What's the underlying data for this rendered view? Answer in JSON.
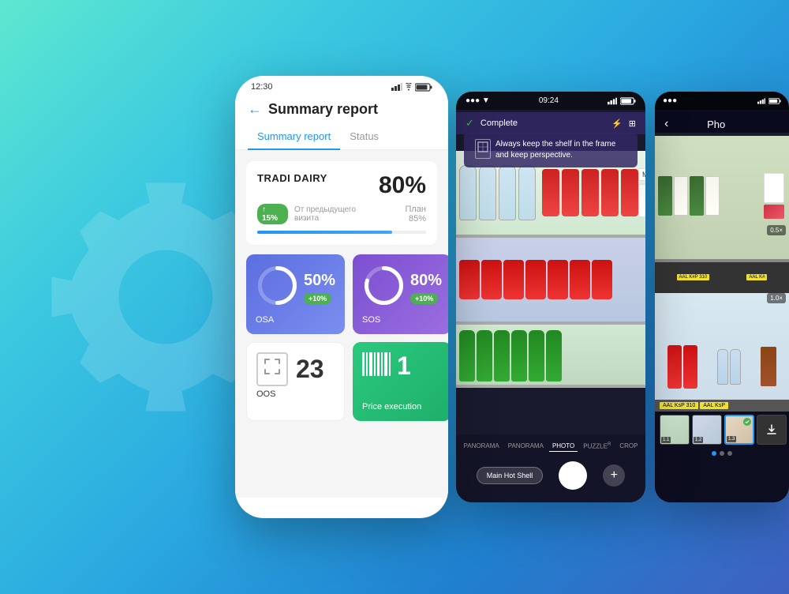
{
  "background": {
    "gradient_start": "#5de8d0",
    "gradient_end": "#4060c0"
  },
  "phone1": {
    "status_bar": {
      "time": "12:30",
      "signal": "▲▼",
      "battery": "🔋"
    },
    "header": {
      "back_icon": "←",
      "title": "Summary report"
    },
    "tabs": [
      {
        "label": "Summary report",
        "active": true
      },
      {
        "label": "Status",
        "active": false
      }
    ],
    "store_card": {
      "name": "TRADI DAIRY",
      "percent": "80%",
      "change_badge": "↑ 15%",
      "meta_text": "От предыдущего визита",
      "plan_text": "План 85%",
      "progress_value": 80
    },
    "metrics": [
      {
        "id": "osa",
        "label": "OSA",
        "value": "50%",
        "change": "+10%",
        "type": "circle_blue"
      },
      {
        "id": "sos",
        "label": "SOS",
        "value": "80%",
        "change": "+10%",
        "type": "circle_purple"
      },
      {
        "id": "oos",
        "label": "OOS",
        "value": "23",
        "type": "number_light"
      },
      {
        "id": "price",
        "label": "Price execution",
        "value": "1",
        "type": "number_green"
      }
    ]
  },
  "phone2": {
    "status_bar": {
      "time": "09:24",
      "left_icons": "●●● ▼"
    },
    "header": {
      "complete_text": "Complete",
      "check_icon": "✓",
      "icons": [
        "⚡",
        "⊞"
      ]
    },
    "hint_text": "Always keep the shelf in the frame and keep perspective.",
    "photo_tabs": [
      "PANORAMA",
      "PANORAMA",
      "PHOTO",
      "PUZZLE",
      "CROP"
    ],
    "active_tab": "PHOTO",
    "controls": {
      "main_shell_label": "Main Hot Shell",
      "plus_label": "+"
    }
  },
  "phone3": {
    "status_bar": {
      "dots": "●●●",
      "icons": "▼ 🔋"
    },
    "header": {
      "back_icon": "‹",
      "title": "Pho"
    },
    "thumb_labels": [
      "1.1",
      "1.2",
      "1.3"
    ],
    "bottom_dots": "● ○ ○"
  }
}
